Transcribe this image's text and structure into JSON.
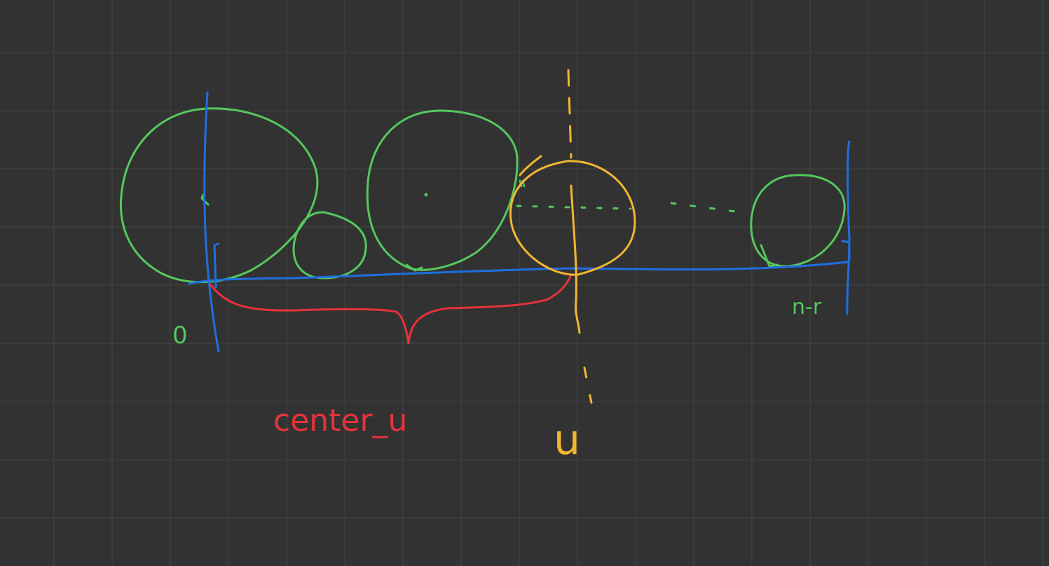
{
  "canvas": {
    "background": "#323232",
    "grid_color": "#444444"
  },
  "colors": {
    "circle": "#55c85e",
    "axis": "#1f6fe0",
    "brace": "#e6323c",
    "query_line": "#f2b632"
  },
  "labels": {
    "origin": "0",
    "end": "n-r",
    "brace": "center_u",
    "query": "u"
  }
}
